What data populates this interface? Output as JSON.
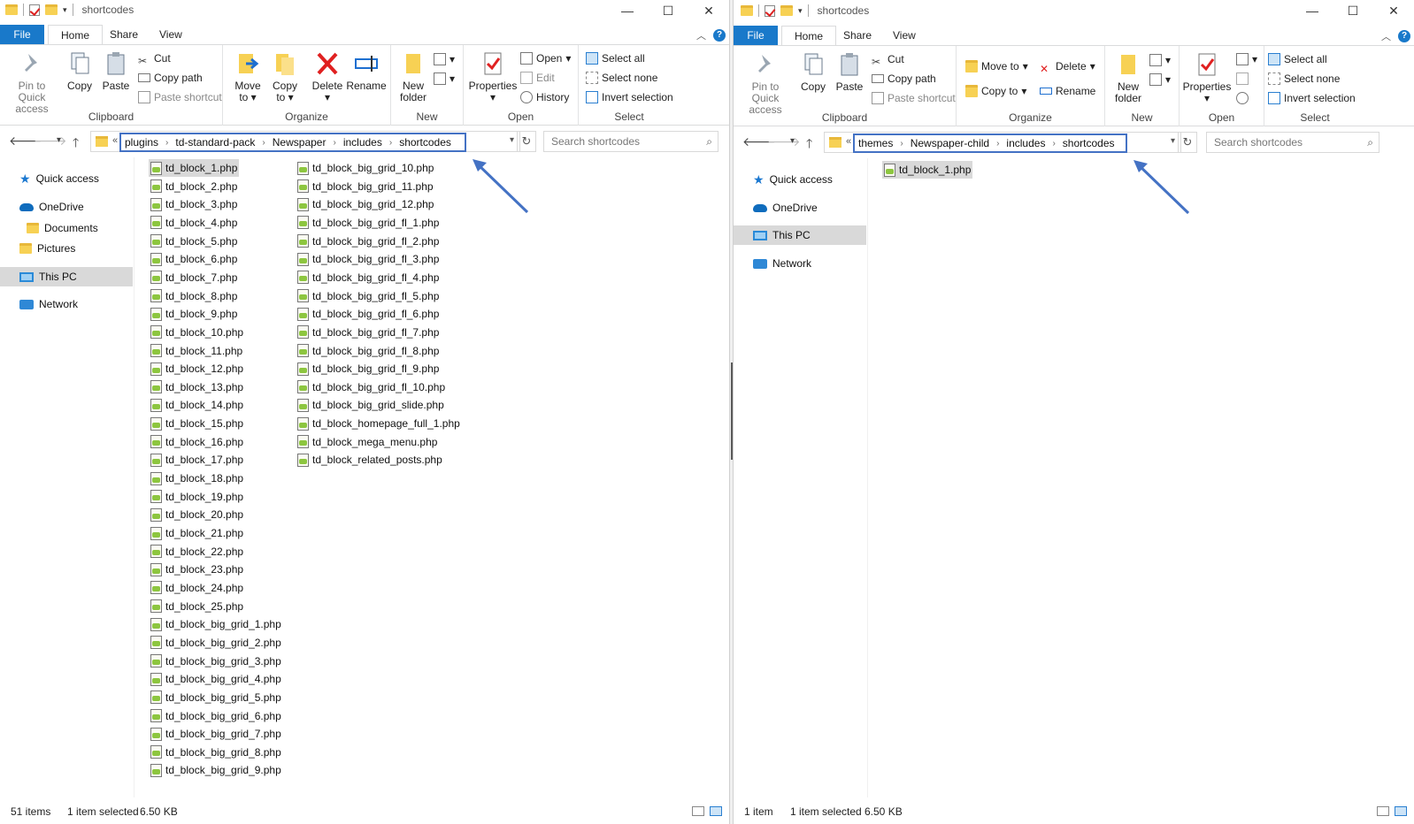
{
  "left": {
    "title": "shortcodes",
    "tabs": {
      "file": "File",
      "home": "Home",
      "share": "Share",
      "view": "View"
    },
    "ribbon": {
      "pin": "Pin to Quick access",
      "copy": "Copy",
      "paste": "Paste",
      "cut": "Cut",
      "copy_path": "Copy path",
      "paste_shortcut": "Paste shortcut",
      "clipboard": "Clipboard",
      "move_to": "Move to",
      "copy_to": "Copy to",
      "delete": "Delete",
      "rename": "Rename",
      "organize": "Organize",
      "new_folder": "New folder",
      "new": "New",
      "properties": "Properties",
      "open": "Open",
      "edit": "Edit",
      "history": "History",
      "open_group": "Open",
      "select_all": "Select all",
      "select_none": "Select none",
      "invert_selection": "Invert selection",
      "select": "Select"
    },
    "breadcrumb": [
      "plugins",
      "td-standard-pack",
      "Newspaper",
      "includes",
      "shortcodes"
    ],
    "search_placeholder": "Search shortcodes",
    "nav": [
      "Quick access",
      "OneDrive",
      "Documents",
      "Pictures",
      "This PC",
      "Network"
    ],
    "files_col1": [
      "td_block_1.php",
      "td_block_2.php",
      "td_block_3.php",
      "td_block_4.php",
      "td_block_5.php",
      "td_block_6.php",
      "td_block_7.php",
      "td_block_8.php",
      "td_block_9.php",
      "td_block_10.php",
      "td_block_11.php",
      "td_block_12.php",
      "td_block_13.php",
      "td_block_14.php",
      "td_block_15.php",
      "td_block_16.php",
      "td_block_17.php",
      "td_block_18.php",
      "td_block_19.php",
      "td_block_20.php",
      "td_block_21.php",
      "td_block_22.php",
      "td_block_23.php",
      "td_block_24.php",
      "td_block_25.php",
      "td_block_big_grid_1.php",
      "td_block_big_grid_2.php",
      "td_block_big_grid_3.php",
      "td_block_big_grid_4.php",
      "td_block_big_grid_5.php",
      "td_block_big_grid_6.php",
      "td_block_big_grid_7.php",
      "td_block_big_grid_8.php",
      "td_block_big_grid_9.php"
    ],
    "files_col2": [
      "td_block_big_grid_10.php",
      "td_block_big_grid_11.php",
      "td_block_big_grid_12.php",
      "td_block_big_grid_fl_1.php",
      "td_block_big_grid_fl_2.php",
      "td_block_big_grid_fl_3.php",
      "td_block_big_grid_fl_4.php",
      "td_block_big_grid_fl_5.php",
      "td_block_big_grid_fl_6.php",
      "td_block_big_grid_fl_7.php",
      "td_block_big_grid_fl_8.php",
      "td_block_big_grid_fl_9.php",
      "td_block_big_grid_fl_10.php",
      "td_block_big_grid_slide.php",
      "td_block_homepage_full_1.php",
      "td_block_mega_menu.php",
      "td_block_related_posts.php"
    ],
    "status": {
      "items": "51 items",
      "selected": "1 item selected",
      "size": "6.50 KB"
    }
  },
  "right": {
    "title": "shortcodes",
    "tabs": {
      "file": "File",
      "home": "Home",
      "share": "Share",
      "view": "View"
    },
    "ribbon": {
      "pin": "Pin to Quick access",
      "copy": "Copy",
      "paste": "Paste",
      "cut": "Cut",
      "copy_path": "Copy path",
      "paste_shortcut": "Paste shortcut",
      "clipboard": "Clipboard",
      "move_to": "Move to",
      "copy_to": "Copy to",
      "delete": "Delete",
      "rename": "Rename",
      "organize": "Organize",
      "new_folder": "New folder",
      "new": "New",
      "properties": "Properties",
      "open_group": "Open",
      "select_all": "Select all",
      "select_none": "Select none",
      "invert_selection": "Invert selection",
      "select": "Select"
    },
    "breadcrumb": [
      "themes",
      "Newspaper-child",
      "includes",
      "shortcodes"
    ],
    "search_placeholder": "Search shortcodes",
    "nav": [
      "Quick access",
      "OneDrive",
      "This PC",
      "Network"
    ],
    "files": [
      "td_block_1.php"
    ],
    "status": {
      "items": "1 item",
      "selected": "1 item selected",
      "size": "6.50 KB"
    }
  },
  "colors": {
    "file_tab": "#1979ca",
    "highlight": "#4472c4",
    "selection": "#d9d9d9"
  }
}
